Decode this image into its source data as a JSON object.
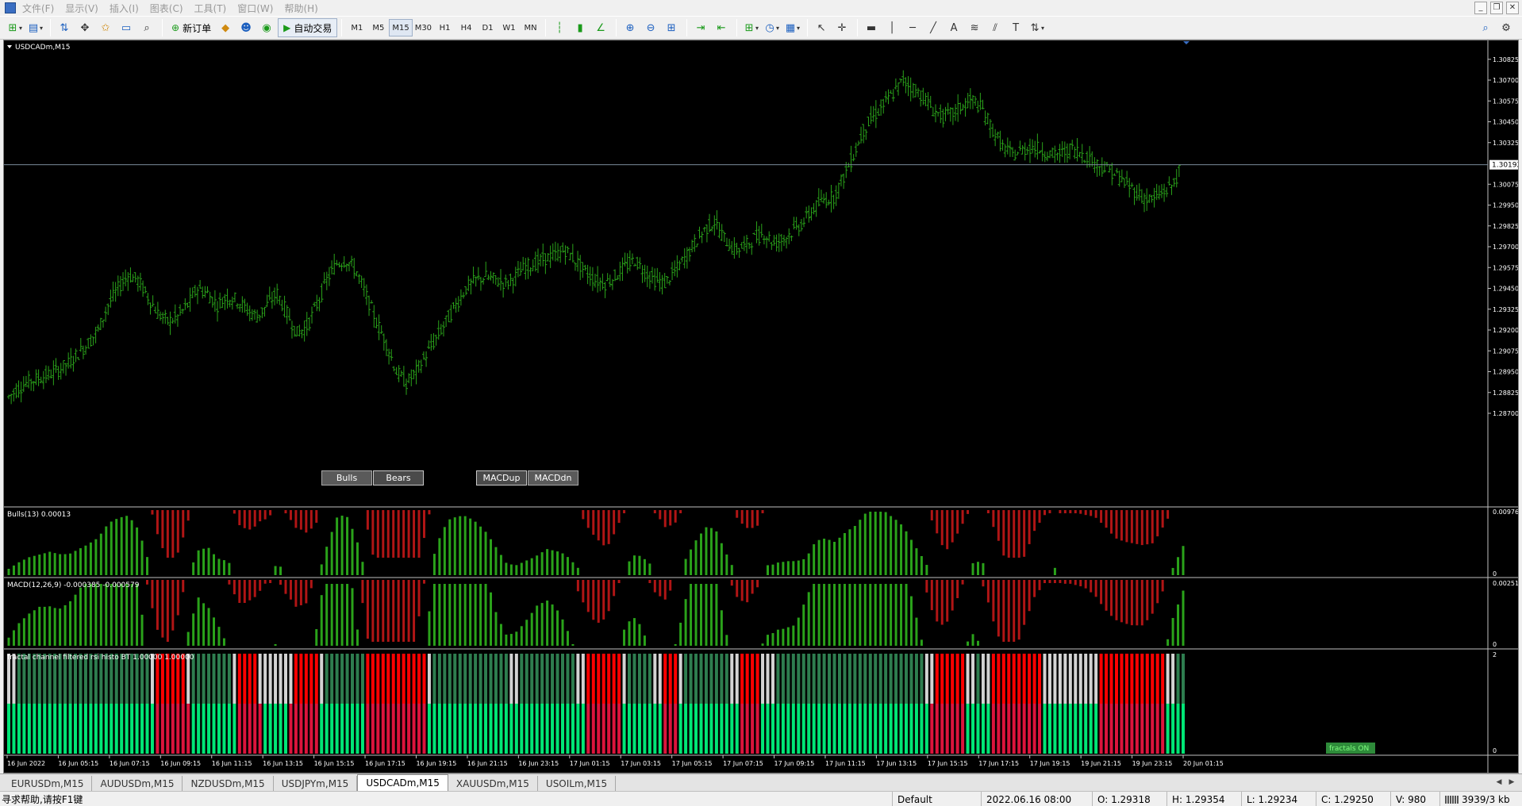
{
  "menu": {
    "items": [
      "文件(F)",
      "显示(V)",
      "插入(I)",
      "图表(C)",
      "工具(T)",
      "窗口(W)",
      "帮助(H)"
    ]
  },
  "window_controls": {
    "minimize": "_",
    "restore": "❐",
    "close": "✕"
  },
  "toolbar": {
    "new_order_label": "新订单",
    "auto_trade_label": "自动交易",
    "timeframes": [
      "M1",
      "M5",
      "M15",
      "M30",
      "H1",
      "H4",
      "D1",
      "W1",
      "MN"
    ],
    "active_timeframe": "M15"
  },
  "chart": {
    "title": "USDCADm,M15",
    "current_price_label": "1.30192",
    "price_ticks": [
      "1.30825",
      "1.30700",
      "1.30575",
      "1.30450",
      "1.30325",
      "1.30192",
      "1.30075",
      "1.29950",
      "1.29825",
      "1.29700",
      "1.29575",
      "1.29450",
      "1.29325",
      "1.29200",
      "1.29075",
      "1.28950",
      "1.28825",
      "1.28700"
    ],
    "time_ticks": [
      "16 Jun 2022",
      "16 Jun 05:15",
      "16 Jun 07:15",
      "16 Jun 09:15",
      "16 Jun 11:15",
      "16 Jun 13:15",
      "16 Jun 15:15",
      "16 Jun 17:15",
      "16 Jun 19:15",
      "16 Jun 21:15",
      "16 Jun 23:15",
      "17 Jun 01:15",
      "17 Jun 03:15",
      "17 Jun 05:15",
      "17 Jun 07:15",
      "17 Jun 09:15",
      "17 Jun 11:15",
      "17 Jun 13:15",
      "17 Jun 15:15",
      "17 Jun 17:15",
      "17 Jun 19:15",
      "19 Jun 21:15",
      "19 Jun 23:15",
      "20 Jun 01:15"
    ],
    "buttons": {
      "bulls": "Bulls",
      "bears": "Bears",
      "macdup": "MACDup",
      "macddn": "MACDdn"
    },
    "colors": {
      "bull_bar": "#2aa21a",
      "bear_bar": "#b01515",
      "bright_green": "#00e676",
      "gray_bar": "#d3d3d3",
      "dark_green": "#2e7d4f",
      "crimson": "#dc143c",
      "red": "#ff0000"
    },
    "indicators": {
      "bulls": {
        "label": "Bulls(13) 0.00013",
        "scale_top": "0.00976",
        "scale_zero": "0"
      },
      "macd": {
        "label": "MACD(12,26,9) -0.000385 -0.000579",
        "scale_top": "0.00251",
        "scale_zero": "0"
      },
      "rsi": {
        "label": "fractal channel filtered rsi histo BT 1.00000 1.00000",
        "scale_top": "2",
        "scale_zero": "0",
        "badge": "fractals ON"
      }
    }
  },
  "chart_data": {
    "type": "ohlc",
    "symbol": "USDCADm",
    "timeframe": "M15",
    "ylim": [
      1.287,
      1.309
    ],
    "close_series": [
      1.288,
      1.2885,
      1.2889,
      1.2891,
      1.2893,
      1.2896,
      1.29,
      1.2906,
      1.2912,
      1.292,
      1.2935,
      1.2945,
      1.2953,
      1.295,
      1.294,
      1.293,
      1.2925,
      1.2928,
      1.2935,
      1.2945,
      1.2942,
      1.2935,
      1.294,
      1.2938,
      1.2932,
      1.2928,
      1.2935,
      1.2942,
      1.293,
      1.2918,
      1.2922,
      1.2935,
      1.295,
      1.296,
      1.2962,
      1.2955,
      1.294,
      1.2925,
      1.2912,
      1.2895,
      1.2888,
      1.2895,
      1.2905,
      1.2915,
      1.2925,
      1.2935,
      1.2945,
      1.295,
      1.2952,
      1.295,
      1.2948,
      1.2952,
      1.2958,
      1.296,
      1.2963,
      1.2965,
      1.2968,
      1.2962,
      1.2955,
      1.295,
      1.2948,
      1.2952,
      1.2958,
      1.2962,
      1.2955,
      1.295,
      1.2948,
      1.2955,
      1.2963,
      1.2972,
      1.298,
      1.2985,
      1.2975,
      1.2968,
      1.297,
      1.2975,
      1.2978,
      1.2972,
      1.2975,
      1.298,
      1.2985,
      1.2993,
      1.2998,
      1.3,
      1.3012,
      1.3025,
      1.304,
      1.3048,
      1.3055,
      1.3062,
      1.307,
      1.3065,
      1.306,
      1.3052,
      1.3048,
      1.305,
      1.3055,
      1.3058,
      1.3052,
      1.304,
      1.303,
      1.3025,
      1.3028,
      1.303,
      1.3028,
      1.3025,
      1.3026,
      1.3029,
      1.3026,
      1.3022,
      1.3018,
      1.3015,
      1.301,
      1.3005,
      1.3,
      1.2998,
      1.3002,
      1.3006,
      1.3018
    ],
    "indicators": {
      "bulls": {
        "name": "Bulls(13)",
        "value": 0.00013
      },
      "macd": {
        "name": "MACD(12,26,9)",
        "main": -0.000385,
        "signal": -0.000579
      },
      "rsi_histo": {
        "name": "fractal channel filtered rsi histo BT",
        "values": [
          1.0,
          1.0
        ]
      }
    }
  },
  "tabs": [
    {
      "label": "EURUSDm,M15",
      "active": false
    },
    {
      "label": "AUDUSDm,M15",
      "active": false
    },
    {
      "label": "NZDUSDm,M15",
      "active": false
    },
    {
      "label": "USDJPYm,M15",
      "active": false
    },
    {
      "label": "USDCADm,M15",
      "active": true
    },
    {
      "label": "XAUUSDm,M15",
      "active": false
    },
    {
      "label": "USOILm,M15",
      "active": false
    }
  ],
  "status": {
    "help": "寻求帮助,请按F1键",
    "profile": "Default",
    "datetime": "2022.06.16 08:00",
    "open": "O: 1.29318",
    "high": "H: 1.29354",
    "low": "L: 1.29234",
    "close": "C: 1.29250",
    "volume": "V: 980",
    "traffic": "3939/3 kb"
  }
}
